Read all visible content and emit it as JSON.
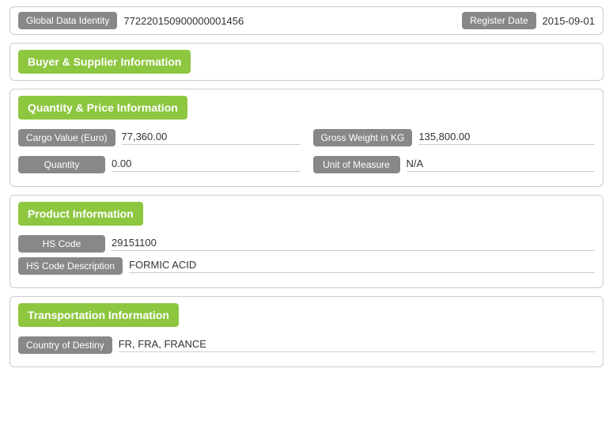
{
  "identity": {
    "global_data_label": "Global Data Identity",
    "global_data_value": "772220150900000001456",
    "register_label": "Register Date",
    "register_value": "2015-09-01"
  },
  "buyer_supplier": {
    "header": "Buyer & Supplier Information"
  },
  "quantity_price": {
    "header": "Quantity & Price Information",
    "cargo_value_label": "Cargo Value (Euro)",
    "cargo_value": "77,360.00",
    "gross_weight_label": "Gross Weight in KG",
    "gross_weight": "135,800.00",
    "quantity_label": "Quantity",
    "quantity_value": "0.00",
    "unit_label": "Unit of Measure",
    "unit_value": "N/A"
  },
  "product": {
    "header": "Product Information",
    "hs_code_label": "HS Code",
    "hs_code_value": "29151100",
    "hs_desc_label": "HS Code Description",
    "hs_desc_value": "FORMIC ACID"
  },
  "transportation": {
    "header": "Transportation Information",
    "country_label": "Country of Destiny",
    "country_value": "FR, FRA, FRANCE"
  }
}
